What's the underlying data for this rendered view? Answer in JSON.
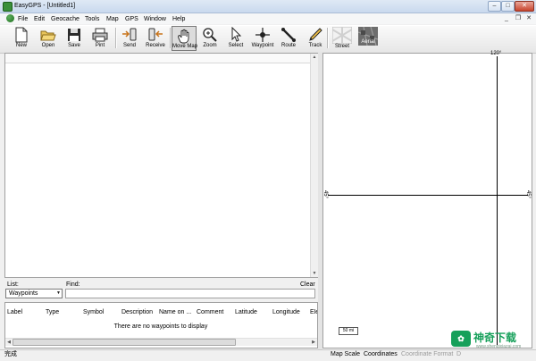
{
  "window": {
    "title": "EasyGPS - [Untitled1]"
  },
  "menubar": {
    "items": [
      "File",
      "Edit",
      "Geocache",
      "Tools",
      "Map",
      "GPS",
      "Window",
      "Help"
    ]
  },
  "toolbar": {
    "new": "New",
    "open": "Open",
    "save": "Save",
    "print": "Pint",
    "send": "Send",
    "receive": "Receive",
    "move_map": "Move Map",
    "zoom": "Zoom",
    "select": "Select",
    "waypoint": "Waypoint",
    "route": "Route",
    "track": "Track",
    "street": "Street",
    "aerial": "Aerial"
  },
  "list_panel": {
    "list_label": "List:",
    "find_label": "Find:",
    "clear_label": "Clear",
    "list_selected": "Waypoints",
    "find_value": "",
    "columns": [
      "Label",
      "Type",
      "Symbol",
      "Description",
      "Name on ...",
      "Comment",
      "Latitude",
      "Longitude",
      "Ele"
    ],
    "empty_message": "There are no waypoints to display"
  },
  "map": {
    "longitude_label": "120°",
    "latitude_label": "45°",
    "scale_label": "50 mi"
  },
  "statusbar": {
    "left": "完成",
    "map_scale": "Map Scale",
    "coordinates": "Coordinates",
    "coordinate_format": "Coordinate Format",
    "cut_off": "D"
  },
  "watermark": {
    "logo_glyph": "✿",
    "text": "神奇下载",
    "url": "www.shenqixiazai.com"
  },
  "colors": {
    "titlebar": "#c9d9ee",
    "app_icon": "#3a8f3a",
    "watermark": "#16a05a"
  }
}
